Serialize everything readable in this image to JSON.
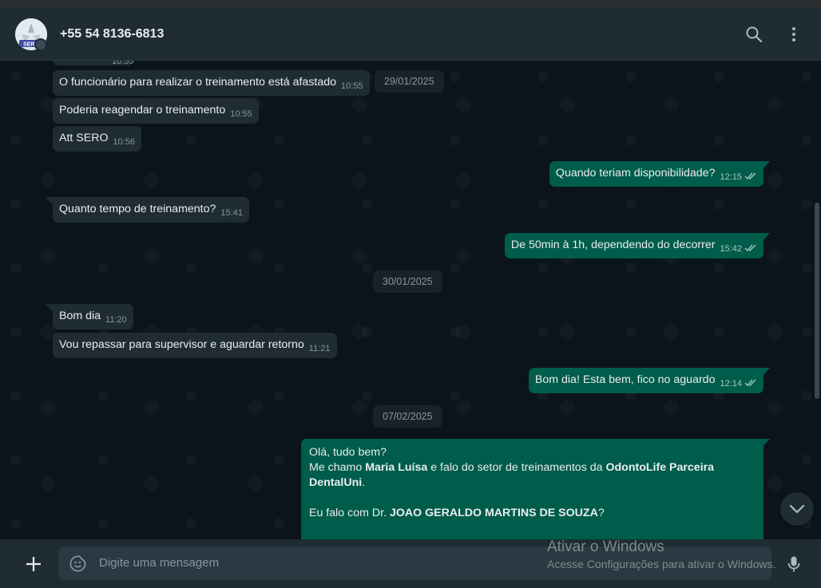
{
  "header": {
    "contact_name": "+55 54 8136-6813",
    "avatar_text": "SERO"
  },
  "chat": {
    "cut_time": "10:55",
    "messages": [
      {
        "dir": "in",
        "text": "O funcionário para realizar o treinamento está afastado",
        "time": "10:55"
      },
      {
        "dir": "in",
        "text": "Poderia reagendar o treinamento",
        "time": "10:55"
      },
      {
        "dir": "in",
        "text": "Att SERO",
        "time": "10:56"
      },
      {
        "dir": "out",
        "text": "Quando teriam disponibilidade?",
        "time": "12:15"
      },
      {
        "dir": "in",
        "text": "Quanto tempo de treinamento?",
        "time": "15:41"
      },
      {
        "dir": "out",
        "text": "De 50min à 1h, dependendo do decorrer",
        "time": "15:42"
      },
      {
        "dir": "in",
        "text": "Bom dia",
        "time": "11:20"
      },
      {
        "dir": "in",
        "text": "Vou repassar para supervisor e aguardar retorno",
        "time": "11:21"
      },
      {
        "dir": "out",
        "text": "Bom dia! Esta bem, fico no aguardo",
        "time": "12:14"
      }
    ],
    "dates": [
      "29/01/2025",
      "30/01/2025",
      "07/02/2025"
    ],
    "long_message": {
      "line1": "Olá, tudo bem?",
      "line2_pre": "Me chamo ",
      "line2_name": "Maria Luísa",
      "line2_mid": " e falo do setor de treinamentos da ",
      "line2_org": "OdontoLife Parceira",
      "line3_org": "DentalUni",
      "line3_end": ".",
      "line4_pre": "Eu falo com Dr. ",
      "line4_name": "JOAO GERALDO MARTINS DE SOUZA",
      "line4_end": "?"
    }
  },
  "footer": {
    "placeholder": "Digite uma mensagem"
  },
  "watermark": {
    "title": "Ativar o Windows",
    "subtitle": "Acesse Configurações para ativar o Windows."
  },
  "colors": {
    "incoming_bubble": "#202c33",
    "outgoing_bubble": "#005c4b",
    "background": "#0b141a",
    "read_ticks": "#a8c6bf"
  },
  "icons": [
    "search-icon",
    "menu-icon",
    "double-check-icon",
    "chevron-down-icon",
    "plus-icon",
    "sticker-icon",
    "microphone-icon"
  ]
}
